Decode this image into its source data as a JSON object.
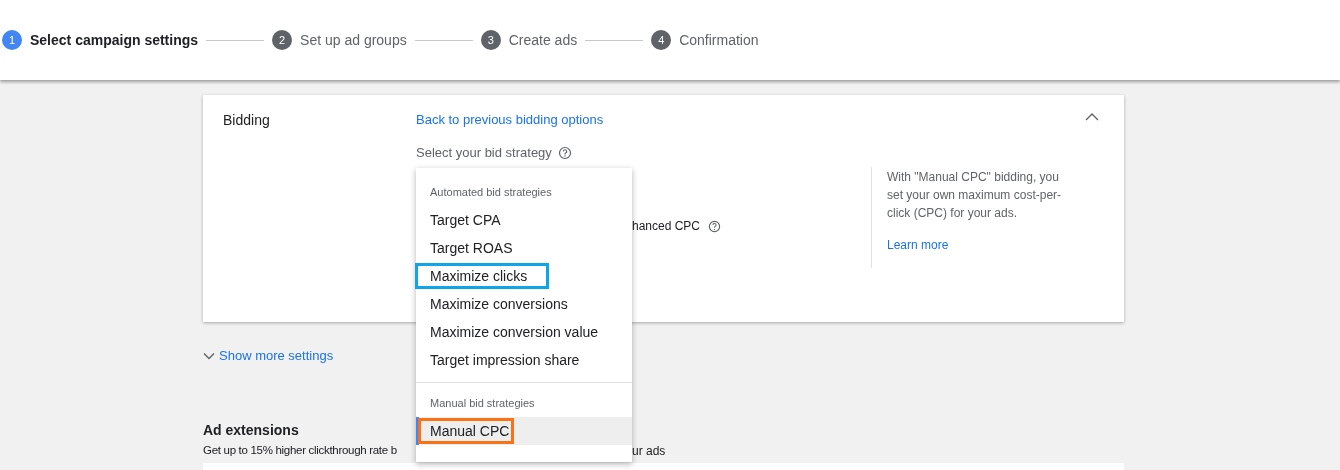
{
  "stepper": [
    {
      "number": "1",
      "label": "Select campaign settings",
      "selected": true
    },
    {
      "number": "2",
      "label": "Set up ad groups",
      "selected": false
    },
    {
      "number": "3",
      "label": "Create ads",
      "selected": false
    },
    {
      "number": "4",
      "label": "Confirmation",
      "selected": false
    }
  ],
  "bidding": {
    "title": "Bidding",
    "back_link": "Back to previous bidding options",
    "prompt": "Select your bid strategy",
    "partial_option": "hanced CPC",
    "expanded": true,
    "info": {
      "text": "With \"Manual CPC\" bidding, you set your own maximum cost-per-click (CPC) for your ads.",
      "link": "Learn more"
    }
  },
  "dropdown": {
    "groups": [
      {
        "header": "Automated bid strategies",
        "items": [
          {
            "label": "Target CPA",
            "selected": false
          },
          {
            "label": "Target ROAS",
            "selected": false
          },
          {
            "label": "Maximize clicks",
            "selected": false,
            "color": "#0ea5e9"
          },
          {
            "label": "Maximize conversions",
            "selected": false
          },
          {
            "label": "Maximize conversion value",
            "selected": false
          },
          {
            "label": "Target impression share",
            "selected": false
          }
        ]
      },
      {
        "header": "Manual bid strategies",
        "items": [
          {
            "label": "Manual CPC",
            "selected": true,
            "color": "#f97316"
          }
        ]
      }
    ]
  },
  "show_more": "Show more settings",
  "ad_extensions": {
    "title": "Ad extensions",
    "description_start": "Get up to 15% higher clickthrough rate b",
    "description_end": "ur ads"
  }
}
